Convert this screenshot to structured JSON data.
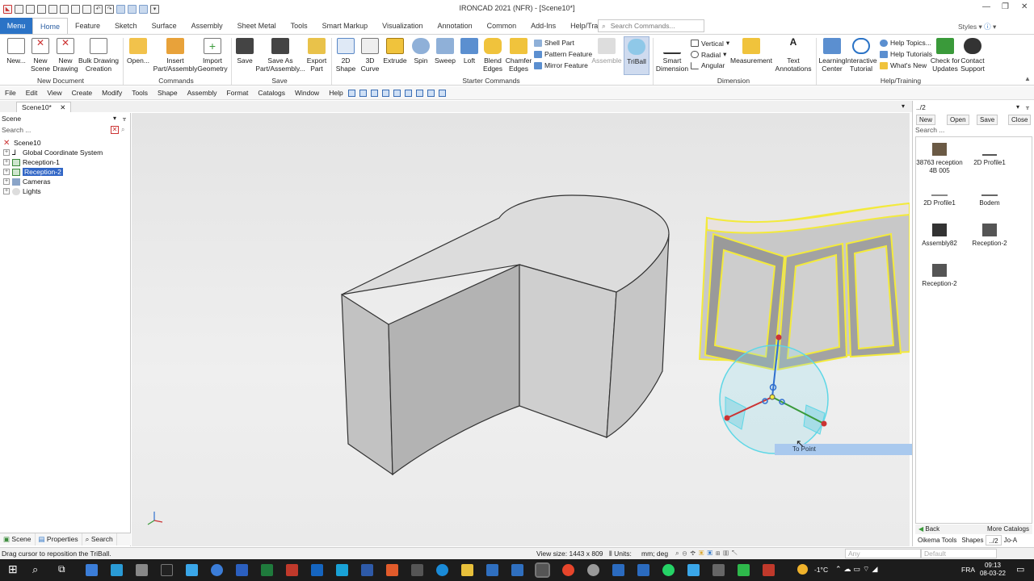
{
  "window": {
    "title": "IRONCAD 2021 (NFR) - [Scene10*]"
  },
  "ribbon": {
    "menu_label": "Menu",
    "tabs": [
      "Home",
      "Feature",
      "Sketch",
      "Surface",
      "Assembly",
      "Sheet Metal",
      "Tools",
      "Smart Markup",
      "Visualization",
      "Annotation",
      "Common",
      "Add-Ins",
      "Help/Training"
    ],
    "search_placeholder": "Search Commands...",
    "styles_label": "Styles",
    "groups": {
      "new_document": "New Document",
      "commands": "Commands",
      "save": "Save",
      "starter_commands": "Starter Commands",
      "dimension": "Dimension",
      "help_training": "Help/Training"
    },
    "buttons": {
      "new": "New...",
      "new_scene": "New\nScene",
      "new_drawing": "New\nDrawing",
      "bulk_drawing": "Bulk Drawing\nCreation",
      "open": "Open...",
      "insert": "Insert\nPart/Assembly",
      "import": "Import\nGeometry",
      "save": "Save",
      "save_as": "Save As\nPart/Assembly...",
      "export": "Export\nPart",
      "shape_2d": "2D\nShape",
      "curve_3d": "3D\nCurve",
      "extrude": "Extrude",
      "spin": "Spin",
      "sweep": "Sweep",
      "loft": "Loft",
      "blend": "Blend\nEdges",
      "chamfer": "Chamfer\nEdges",
      "shell": "Shell Part",
      "pattern": "Pattern Feature",
      "mirror": "Mirror Feature",
      "assemble": "Assemble",
      "triball": "TriBall",
      "smart_dim": "Smart\nDimension",
      "vertical": "Vertical",
      "radial": "Radial",
      "angular": "Angular",
      "measurement": "Measurement",
      "text_ann": "Text\nAnnotations",
      "learning": "Learning\nCenter",
      "interactive": "Interactive\nTutorial",
      "help_topics": "Help Topics...",
      "help_tutorials": "Help Tutorials",
      "whats_new": "What's New",
      "check_updates": "Check for\nUpdates",
      "contact": "Contact\nSupport"
    }
  },
  "menubar": [
    "File",
    "Edit",
    "View",
    "Create",
    "Modify",
    "Tools",
    "Shape",
    "Assembly",
    "Format",
    "Catalogs",
    "Window",
    "Help"
  ],
  "document_tab": "Scene10*",
  "scene_panel": {
    "title": "Scene",
    "search": "Search ...",
    "tree": [
      "Scene10",
      "Global Coordinate System",
      "Reception-1",
      "Reception-2",
      "Cameras",
      "Lights"
    ],
    "tabs": [
      "Scene",
      "Properties",
      "Search"
    ]
  },
  "viewport": {
    "tooltip": "To Point"
  },
  "catalog_panel": {
    "path": "../2",
    "buttons": [
      "New",
      "Open",
      "Save",
      "Close"
    ],
    "search": "Search ...",
    "items": [
      "38763 reception 4B 005",
      "2D Profile1",
      "2D Profile1",
      "Bodem",
      "Assembly82",
      "Reception-2",
      "Reception-2"
    ],
    "footer": [
      "Back",
      "More Catalogs"
    ],
    "tabs": [
      "Oikema Tools",
      "Shapes",
      "../2",
      "Jo-A"
    ]
  },
  "status": {
    "message": "Drag cursor to reposition the TriBall.",
    "view_size": "View size: 1443 x 809",
    "units": "Units:",
    "units_value": "mm; deg",
    "any": "Any",
    "default": "Default"
  },
  "taskbar": {
    "weather": "-1°C",
    "lang": "FRA",
    "time": "09:13",
    "date": "08-03-22"
  }
}
